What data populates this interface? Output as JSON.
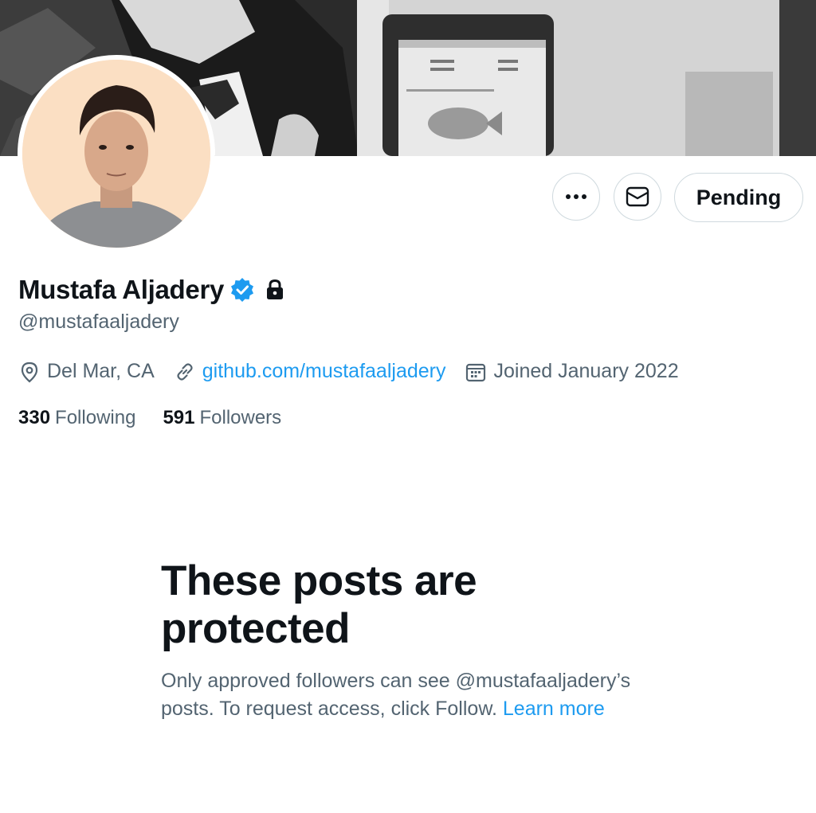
{
  "profile": {
    "display_name": "Mustafa Aljadery",
    "handle": "@mustafaaljadery",
    "location": "Del Mar, CA",
    "website": "github.com/mustafaaljadery",
    "joined": "Joined January 2022",
    "following_count": "330",
    "following_label": "Following",
    "followers_count": "591",
    "followers_label": "Followers",
    "verified": true,
    "protected": true
  },
  "actions": {
    "more_icon": "more-horizontal-icon",
    "message_icon": "envelope-icon",
    "pending_label": "Pending"
  },
  "protected_notice": {
    "title": "These posts are protected",
    "body": "Only approved followers can see @mustafaaljadery’s posts. To request access, click Follow.",
    "link": "Learn more"
  },
  "colors": {
    "accent": "#1d9bf0",
    "text_primary": "#0f1419",
    "text_secondary": "#536471",
    "border": "#cfd9de"
  }
}
